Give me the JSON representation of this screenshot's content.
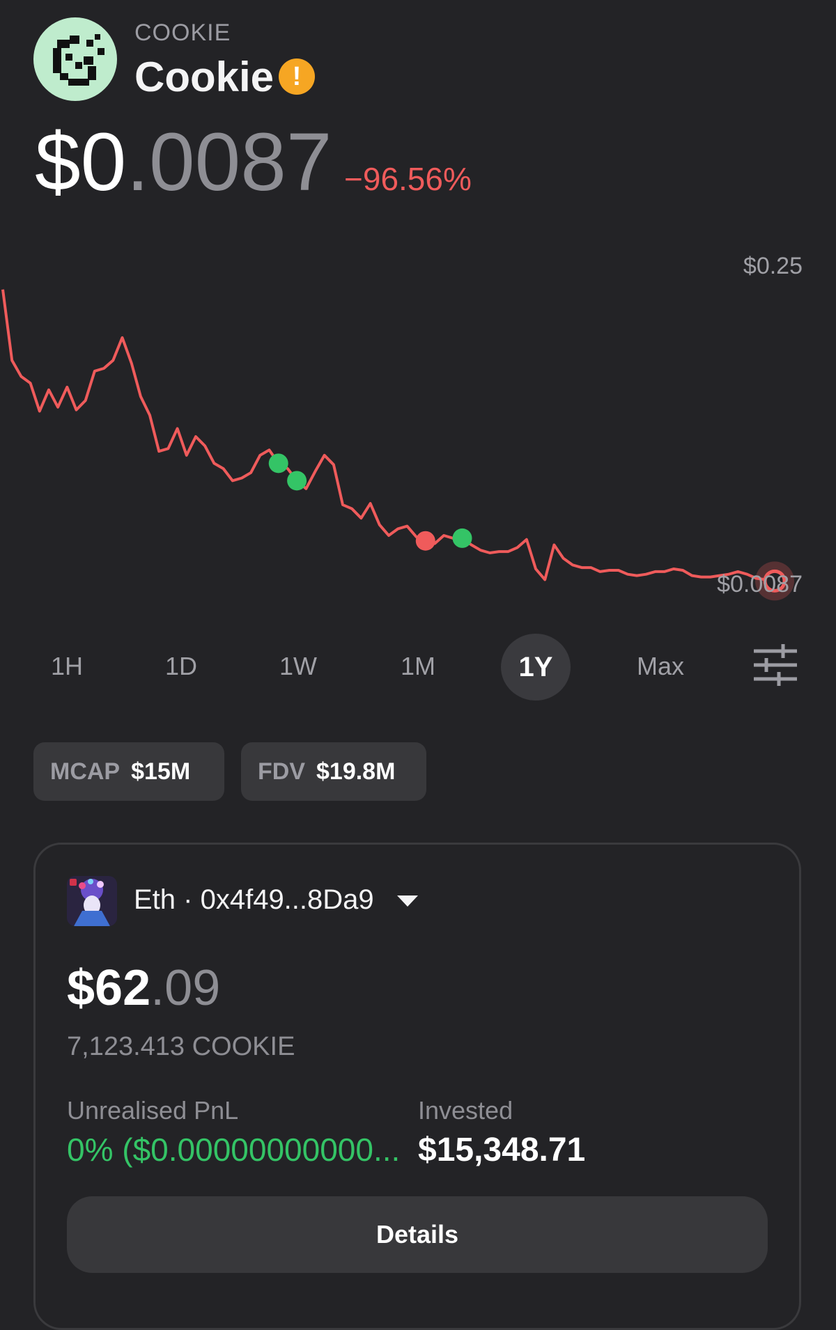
{
  "token": {
    "ticker": "COOKIE",
    "name": "Cookie",
    "warning_icon": "exclamation",
    "price_whole": "$0",
    "price_fraction": ".0087",
    "change": "−96.56%"
  },
  "chart_data": {
    "type": "line",
    "range": "1Y",
    "y_max_label": "$0.25",
    "y_min_label": "$0.0087",
    "color": "#ef5b5b",
    "ylim": [
      0.0087,
      0.25
    ],
    "series": [
      {
        "values": [
          0.262,
          0.209,
          0.197,
          0.192,
          0.171,
          0.187,
          0.174,
          0.189,
          0.172,
          0.179,
          0.201,
          0.203,
          0.209,
          0.226,
          0.207,
          0.182,
          0.168,
          0.141,
          0.143,
          0.158,
          0.138,
          0.152,
          0.145,
          0.132,
          0.128,
          0.119,
          0.121,
          0.125,
          0.138,
          0.142,
          0.132,
          0.128,
          0.119,
          0.113,
          0.126,
          0.138,
          0.131,
          0.101,
          0.098,
          0.091,
          0.102,
          0.086,
          0.078,
          0.083,
          0.085,
          0.077,
          0.074,
          0.072,
          0.078,
          0.076,
          0.076,
          0.071,
          0.067,
          0.065,
          0.066,
          0.066,
          0.069,
          0.075,
          0.053,
          0.045,
          0.071,
          0.061,
          0.056,
          0.054,
          0.054,
          0.051,
          0.052,
          0.052,
          0.049,
          0.048,
          0.049,
          0.051,
          0.051,
          0.053,
          0.052,
          0.048,
          0.047,
          0.047,
          0.048,
          0.049,
          0.051,
          0.049,
          0.046,
          0.045,
          0.044
        ]
      }
    ],
    "markers": [
      {
        "index": 30,
        "kind": "buy",
        "color": "#34c466"
      },
      {
        "index": 32,
        "kind": "buy",
        "color": "#34c466"
      },
      {
        "index": 46,
        "kind": "sell",
        "color": "#ef5b5b"
      },
      {
        "index": 50,
        "kind": "buy",
        "color": "#34c466"
      }
    ]
  },
  "ranges": [
    "1H",
    "1D",
    "1W",
    "1M",
    "1Y",
    "Max"
  ],
  "active_range": "1Y",
  "filter_icon": "sliders-icon",
  "stats": {
    "mcap_label": "MCAP",
    "mcap_value": "$15M",
    "fdv_label": "FDV",
    "fdv_value": "$19.8M"
  },
  "wallet": {
    "label": "Eth · 0x4f49...8Da9",
    "holding_whole": "$62",
    "holding_fraction": ".09",
    "amount": "7,123.413 COOKIE",
    "pnl_label": "Unrealised PnL",
    "pnl_value": "0% ($0.00000000000...",
    "invested_label": "Invested",
    "invested_value": "$15,348.71",
    "details_label": "Details"
  }
}
